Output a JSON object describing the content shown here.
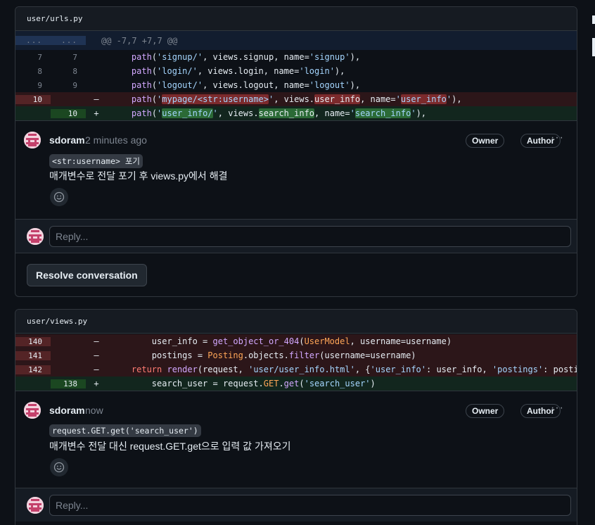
{
  "threads": [
    {
      "file": "user/urls.py",
      "hunk": {
        "left": "...",
        "right": "...",
        "text": "@@ -7,7 +7,7 @@"
      },
      "lines": [
        {
          "old": "7",
          "new": "7",
          "type": "ctx",
          "tokens": [
            [
              "plain",
              "    "
            ],
            [
              "fn",
              "path"
            ],
            [
              "plain",
              "("
            ],
            [
              "str",
              "'signup/'"
            ],
            [
              "plain",
              ", views.signup, name="
            ],
            [
              "str",
              "'signup'"
            ],
            [
              "plain",
              "),"
            ]
          ]
        },
        {
          "old": "8",
          "new": "8",
          "type": "ctx",
          "tokens": [
            [
              "plain",
              "    "
            ],
            [
              "fn",
              "path"
            ],
            [
              "plain",
              "("
            ],
            [
              "str",
              "'login/'"
            ],
            [
              "plain",
              ", views.login, name="
            ],
            [
              "str",
              "'login'"
            ],
            [
              "plain",
              "),"
            ]
          ]
        },
        {
          "old": "9",
          "new": "9",
          "type": "ctx",
          "tokens": [
            [
              "plain",
              "    "
            ],
            [
              "fn",
              "path"
            ],
            [
              "plain",
              "("
            ],
            [
              "str",
              "'logout/'"
            ],
            [
              "plain",
              ", views.logout, name="
            ],
            [
              "str",
              "'logout'"
            ],
            [
              "plain",
              "),"
            ]
          ]
        },
        {
          "old": "10",
          "new": "",
          "type": "del",
          "marker": "-",
          "tokens": [
            [
              "plain",
              "    "
            ],
            [
              "fn",
              "path"
            ],
            [
              "plain",
              "("
            ],
            [
              "str",
              "'"
            ],
            [
              "hl-str",
              "mypage/<str:username>"
            ],
            [
              "str",
              "'"
            ],
            [
              "plain",
              ", views."
            ],
            [
              "hl-plain",
              "user_info"
            ],
            [
              "plain",
              ", name="
            ],
            [
              "str",
              "'"
            ],
            [
              "hl-str",
              "user_info"
            ],
            [
              "str",
              "'"
            ],
            [
              "plain",
              "),"
            ]
          ]
        },
        {
          "old": "",
          "new": "10",
          "type": "add",
          "marker": "+",
          "tokens": [
            [
              "plain",
              "    "
            ],
            [
              "fn",
              "path"
            ],
            [
              "plain",
              "("
            ],
            [
              "str",
              "'"
            ],
            [
              "hl-str",
              "user_info/"
            ],
            [
              "str",
              "'"
            ],
            [
              "plain",
              ", views."
            ],
            [
              "hl-plain",
              "search_info"
            ],
            [
              "plain",
              ", name="
            ],
            [
              "str",
              "'"
            ],
            [
              "hl-str",
              "search_info"
            ],
            [
              "str",
              "'"
            ],
            [
              "plain",
              "),"
            ]
          ]
        }
      ],
      "comment": {
        "author": "sdoram",
        "time": "2 minutes ago",
        "badges": [
          "Owner",
          "Author"
        ],
        "more": "···",
        "code": "<str:username> 포기",
        "text": "매개변수로 전달 포기 후 views.py에서 해결",
        "reaction_icon": "smiley-icon"
      },
      "reply_placeholder": "Reply...",
      "resolve_label": "Resolve conversation"
    },
    {
      "file": "user/views.py",
      "lines": [
        {
          "old": "140",
          "new": "",
          "type": "del",
          "marker": "-",
          "tokens": [
            [
              "plain",
              "        user_info = "
            ],
            [
              "fn",
              "get_object_or_404"
            ],
            [
              "plain",
              "("
            ],
            [
              "cls",
              "UserModel"
            ],
            [
              "plain",
              ", username=username)"
            ]
          ]
        },
        {
          "old": "141",
          "new": "",
          "type": "del",
          "marker": "-",
          "tokens": [
            [
              "plain",
              "        postings = "
            ],
            [
              "cls",
              "Posting"
            ],
            [
              "plain",
              ".objects."
            ],
            [
              "fn",
              "filter"
            ],
            [
              "plain",
              "(username=username)"
            ]
          ]
        },
        {
          "old": "142",
          "new": "",
          "type": "del",
          "marker": "-",
          "tokens": [
            [
              "plain",
              "    "
            ],
            [
              "kw",
              "return"
            ],
            [
              "plain",
              " "
            ],
            [
              "fn",
              "render"
            ],
            [
              "plain",
              "(request, "
            ],
            [
              "str",
              "'user/user_info.html'"
            ],
            [
              "plain",
              ", {"
            ],
            [
              "str",
              "'user_info'"
            ],
            [
              "plain",
              ": user_info, "
            ],
            [
              "str",
              "'postings'"
            ],
            [
              "plain",
              ": postings})"
            ]
          ]
        },
        {
          "old": "",
          "new": "138",
          "type": "add",
          "marker": "+",
          "tokens": [
            [
              "plain",
              "        search_user = request."
            ],
            [
              "cls",
              "GET"
            ],
            [
              "plain",
              "."
            ],
            [
              "fn",
              "get"
            ],
            [
              "plain",
              "("
            ],
            [
              "str",
              "'search_user'"
            ],
            [
              "plain",
              ")"
            ]
          ]
        }
      ],
      "comment": {
        "author": "sdoram",
        "time": "now",
        "badges": [
          "Owner",
          "Author"
        ],
        "more": "···",
        "code": "request.GET.get('search_user')",
        "text": "매개변수 전달 대신 request.GET.get으로 입력 값 가져오기",
        "reaction_icon": "smiley-icon"
      },
      "reply_placeholder": "Reply..."
    }
  ],
  "colors": {
    "bg": "#0d1117",
    "border": "#30363d",
    "del_bg": "#2c1619",
    "add_bg": "#12261e",
    "hunk_bg": "#121d2f"
  }
}
